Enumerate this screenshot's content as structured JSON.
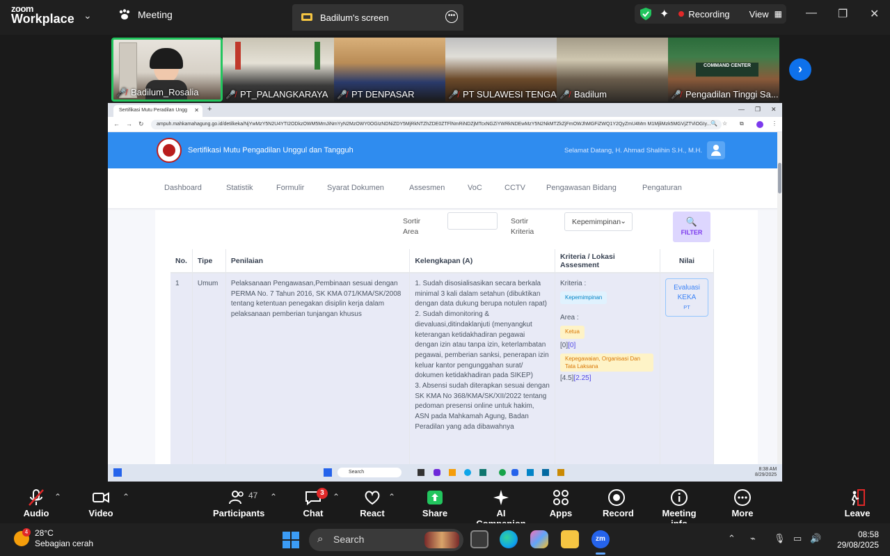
{
  "zoom": {
    "brand_line1": "zoom",
    "brand_line2": "Workplace",
    "meeting_tab": "Meeting",
    "screen_tab": "Badilum's screen",
    "recording_label": "Recording",
    "view_label": "View",
    "accent": "#0e71eb",
    "recording_color": "#e02828"
  },
  "participants": [
    {
      "name": "Badilum_Rosalia",
      "active": true
    },
    {
      "name": "PT_PALANGKARAYA"
    },
    {
      "name": "PT DENPASAR"
    },
    {
      "name": "PT SULAWESI TENGAH"
    },
    {
      "name": "Badilum"
    },
    {
      "name": "Pengadilan Tinggi Sa..."
    }
  ],
  "browser": {
    "tab_title": "Sertifikasi Mutu Peradilan Ungg",
    "url": "ampuh.mahkamahagung.go.id/detilkeka/NjYwMzY5N2U4YTI2ODkzOWM5MmJiNmYyN2MzOWY0OGIzNDNiZDY5MjRkNTZhZDE0ZTFlNmRiNDZjMTcxNGZiYWRkNDEwMzY5N2NkMTZkZjFmOWJhMGFiZWQ1Y2QyZmU4Mm M1MjliMzk5MGVjZTViOGIy..."
  },
  "site": {
    "title": "Sertifikasi Mutu Pengadilan Unggul dan Tangguh",
    "welcome": "Selamat Datang, H. Ahmad Shalihin S.H., M.H.",
    "nav": [
      "Dashboard",
      "Statistik",
      "Formulir",
      "Syarat Dokumen",
      "Assesmen",
      "VoC",
      "CCTV",
      "Pengawasan Bidang",
      "Pengaturan"
    ],
    "filter": {
      "area_label_1": "Sortir",
      "area_label_2": "Area",
      "criteria_label_1": "Sortir",
      "criteria_label_2": "Kriteria",
      "criteria_value": "Kepemimpinan",
      "button": "FILTER"
    },
    "table": {
      "headers": [
        "No.",
        "Tipe",
        "Penilaian",
        "Kelengkapan (A)",
        "Kriteria / Lokasi Assesment",
        "Nilai"
      ],
      "row": {
        "no": "1",
        "tipe": "Umum",
        "penilaian": "Pelaksanaan Pengawasan,Pembinaan sesuai dengan PERMA No. 7 Tahun 2016, SK KMA 071/KMA/SK/2008 tentang ketentuan penegakan disiplin kerja dalam pelaksanaan pemberian tunjangan khusus",
        "kelengkapan": [
          "1. Sudah disosialisasikan secara berkala minimal 3 kali dalam setahun (dibuktikan dengan data dukung berupa notulen rapat)",
          "2. Sudah dimonitoring & dievaluasi,ditindaklanjuti (menyangkut keterangan ketidakhadiran pegawai dengan izin atau tanpa izin, keterlambatan pegawai, pemberian sanksi, penerapan izin keluar kantor pengunggahan surat/ dokumen ketidakhadiran pada SIKEP)",
          "3. Absensi sudah diterapkan sesuai dengan SK KMA No 368/KMA/SK/XII/2022 tentang pedoman presensi online untuk hakim, ASN pada Mahkamah Agung, Badan Peradilan yang ada dibawahnya"
        ],
        "kriteria_label": "Kriteria :",
        "kriteria_badge": "Kepemimpinan",
        "area_label": "Area :",
        "area1_badge": "Ketua",
        "area1_score_a": "[0]",
        "area1_score_b": "[0]",
        "area2_badge": "Kepegawaian, Organisasi Dan Tata Laksana",
        "area2_score_a": "[4.5]",
        "area2_score_b": "[2.25]",
        "nilai_line1": "Evaluasi",
        "nilai_line2": "KEKA",
        "nilai_line3": "PT"
      }
    },
    "taskbar_search": "Search",
    "taskbar_time": "8:38 AM",
    "taskbar_date": "8/29/2025"
  },
  "toolbar": {
    "audio": "Audio",
    "video": "Video",
    "participants": "Participants",
    "participants_count": "47",
    "chat": "Chat",
    "chat_badge": "3",
    "react": "React",
    "share": "Share",
    "ai": "AI Companion",
    "apps": "Apps",
    "record": "Record",
    "info": "Meeting info",
    "more": "More",
    "leave": "Leave",
    "share_color": "#22c55e",
    "leave_color": "#e02828"
  },
  "windows": {
    "weather_temp": "28°C",
    "weather_desc": "Sebagian cerah",
    "weather_badge": "4",
    "search": "Search",
    "time": "08:58",
    "date": "29/08/2025"
  }
}
